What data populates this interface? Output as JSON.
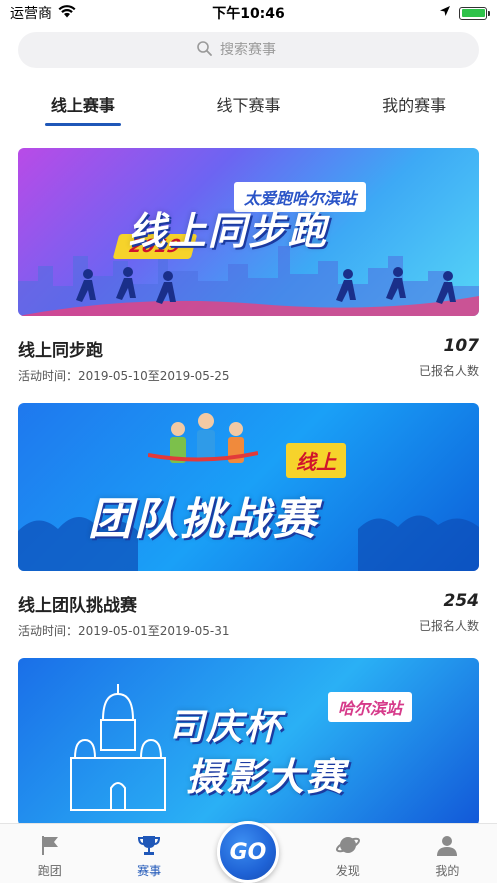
{
  "status_bar": {
    "carrier": "运营商",
    "time": "下午10:46"
  },
  "search": {
    "placeholder": "搜索赛事"
  },
  "tabs": [
    {
      "label": "线上赛事",
      "active": true
    },
    {
      "label": "线下赛事",
      "active": false
    },
    {
      "label": "我的赛事",
      "active": false
    }
  ],
  "events": [
    {
      "banner_text": "线上同步跑",
      "banner_tag": "太爱跑哈尔滨站",
      "banner_year": "2019",
      "title": "线上同步跑",
      "date": "活动时间：2019-05-10至2019-05-25",
      "count": "107",
      "count_label": "已报名人数"
    },
    {
      "banner_text": "团队挑战赛",
      "banner_tag": "线上",
      "title": "线上团队挑战赛",
      "date": "活动时间：2019-05-01至2019-05-31",
      "count": "254",
      "count_label": "已报名人数"
    },
    {
      "banner_text_line1": "司庆杯",
      "banner_text_line2": "摄影大赛",
      "banner_tag": "哈尔滨站"
    }
  ],
  "bottom_nav": [
    {
      "label": "跑团",
      "icon": "flag-icon",
      "active": false
    },
    {
      "label": "赛事",
      "icon": "trophy-icon",
      "active": true
    },
    {
      "label": "GO",
      "icon": "go-button",
      "active": false
    },
    {
      "label": "发现",
      "icon": "planet-icon",
      "active": false
    },
    {
      "label": "我的",
      "icon": "user-icon",
      "active": false
    }
  ],
  "colors": {
    "accent": "#1f57b8",
    "battery": "#2ec24a"
  }
}
